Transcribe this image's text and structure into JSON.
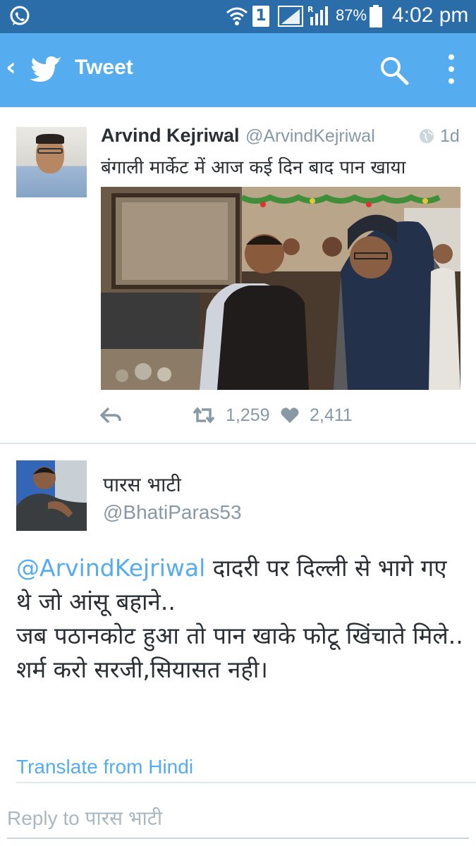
{
  "status_bar": {
    "sim_slot": "1",
    "battery": "87%",
    "time": "4:02 pm",
    "signal_indicator": "R",
    "icons": [
      "whatsapp-icon",
      "wifi-icon",
      "sim-icon",
      "signal-icon",
      "battery-icon"
    ]
  },
  "app_bar": {
    "back": "‹",
    "title": "Tweet",
    "accent_color": "#55acee",
    "icons": [
      "twitter-bird-icon",
      "search-icon",
      "overflow-menu-icon"
    ]
  },
  "tweet": {
    "name": "Arvind Kejriwal",
    "handle": "@ArvindKejriwal",
    "time": "1d",
    "text": "बंगाली मार्केट में आज कई दिन बाद पान खाया",
    "retweets": "1,259",
    "likes": "2,411"
  },
  "reply_tweet": {
    "name": "पारस भाटी",
    "handle": "@BhatiParas53",
    "mention": "@ArvindKejriwal",
    "line1": " दादरी पर दिल्ली से भागे गए थे जो आंसू बहाने..",
    "line2": "जब पठानकोट हुआ तो पान खाके फोटू खिंचाते मिले..",
    "line3": "शर्म करो सरजी,सियासत नही।",
    "translate_label": "Translate from Hindi"
  },
  "reply_box": {
    "placeholder_prefix": "Reply to ",
    "placeholder_name": "पारस भाटी"
  }
}
